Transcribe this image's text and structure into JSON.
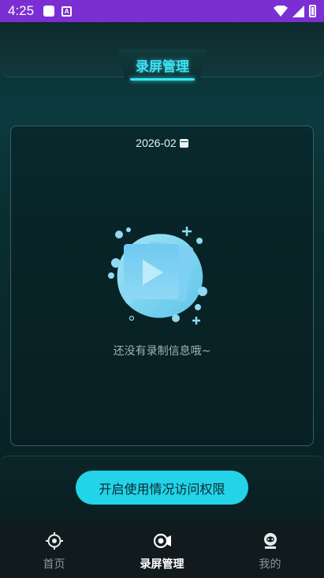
{
  "status_bar": {
    "time": "4:25",
    "background": "#7b2fd3",
    "icons": [
      "notification-square-icon",
      "a-badge-icon",
      "wifi-icon",
      "signal-icon",
      "battery-icon"
    ]
  },
  "header": {
    "title": "录屏管理",
    "accent": "#3fe0f0"
  },
  "card": {
    "date": "2026-02",
    "date_icon": "calendar-icon",
    "empty_message": "还没有录制信息哦~",
    "illustration": "video-play-splash-icon"
  },
  "action": {
    "permission_label": "开启使用情况访问权限",
    "button_color": "#23d3e8"
  },
  "tabbar": {
    "tabs": [
      {
        "label": "首页",
        "icon": "target-icon",
        "active": false
      },
      {
        "label": "录屏管理",
        "icon": "record-camera-icon",
        "active": true
      },
      {
        "label": "我的",
        "icon": "profile-icon",
        "active": false
      }
    ]
  }
}
